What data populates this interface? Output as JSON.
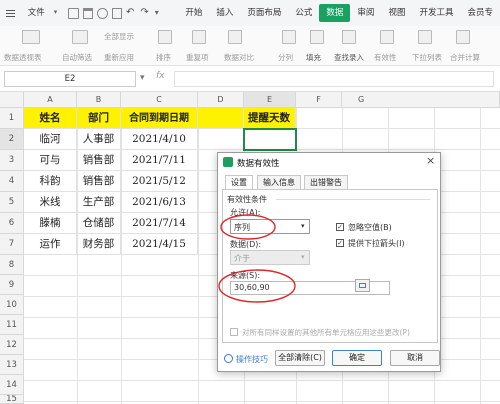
{
  "menubar": {
    "file_label": "文件",
    "tabs": [
      "开始",
      "插入",
      "页面布局",
      "公式",
      "数据",
      "审阅",
      "视图",
      "开发工具",
      "会员专"
    ],
    "active_tab": "数据"
  },
  "ribbon": {
    "items": [
      "数据透视表",
      "自动筛选",
      "全部显示",
      "重新应用",
      "排序",
      "重复项",
      "数据对比",
      "分列",
      "填充",
      "查找录入",
      "有效性",
      "下拉列表",
      "合并计算"
    ]
  },
  "formula_bar": {
    "name_box": "E2",
    "fx": "fx"
  },
  "sheet": {
    "columns": [
      "A",
      "B",
      "C",
      "D",
      "E",
      "F",
      "G"
    ],
    "rows": [
      "1",
      "2",
      "3",
      "4",
      "5",
      "6",
      "7",
      "8",
      "9",
      "10",
      "11",
      "12",
      "13",
      "14",
      "15"
    ],
    "header": [
      "姓名",
      "部门",
      "合同到期日期",
      "",
      "提醒天数"
    ],
    "data": [
      [
        "临河",
        "人事部",
        "2021/4/10"
      ],
      [
        "可与",
        "销售部",
        "2021/7/11"
      ],
      [
        "科韵",
        "销售部",
        "2021/5/12"
      ],
      [
        "米线",
        "生产部",
        "2021/6/13"
      ],
      [
        "滕楠",
        "仓储部",
        "2021/7/14"
      ],
      [
        "运作",
        "财务部",
        "2021/4/15"
      ]
    ]
  },
  "dialog": {
    "title": "数据有效性",
    "tabs": [
      "设置",
      "输入信息",
      "出错警告"
    ],
    "section": "有效性条件",
    "allow_label": "允许(A):",
    "allow_value": "序列",
    "data_label": "数据(D):",
    "data_value": "介于",
    "ignore_blank": "忽略空值(B)",
    "dropdown_arrow": "提供下拉箭头(I)",
    "source_label": "来源(S):",
    "source_value": "30,60,90",
    "apply_all": "对所有同样设置的其他所有单元格应用这些更改(P)",
    "tips": "操作技巧",
    "clear_all": "全部清除(C)",
    "ok": "确定",
    "cancel": "取消"
  },
  "colors": {
    "accent": "#1aa060",
    "header_fill": "#fff200",
    "annotation": "#e0262b"
  }
}
